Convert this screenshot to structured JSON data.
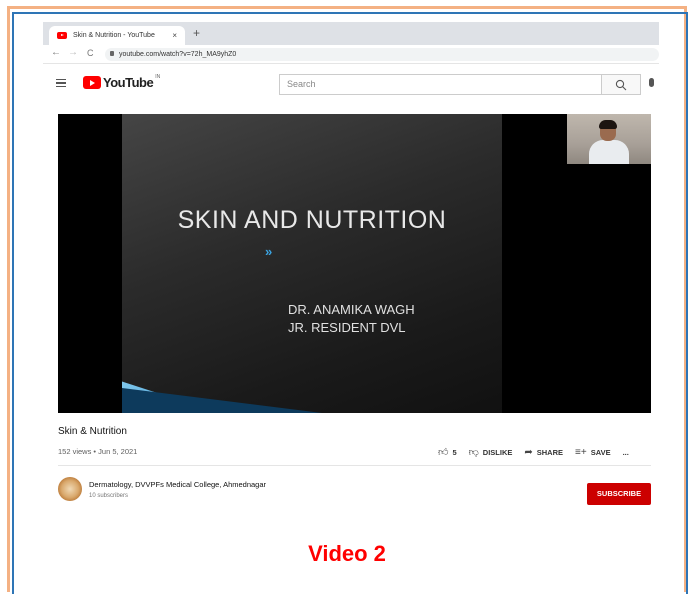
{
  "browser": {
    "tab_title": "Skin & Nutrition - YouTube",
    "tab_close": "×",
    "new_tab": "+",
    "back": "←",
    "forward": "→",
    "reload": "C",
    "url": "youtube.com/watch?v=72h_MA9yhZ0"
  },
  "youtube": {
    "logo_text": "YouTube",
    "region": "IN",
    "search_placeholder": "Search"
  },
  "slide": {
    "title": "SKIN AND NUTRITION",
    "arrow": "»",
    "presenter_line1": "DR. ANAMIKA WAGH",
    "presenter_line2": "JR. RESIDENT DVL"
  },
  "video": {
    "title": "Skin & Nutrition",
    "meta": "152 views • Jun 5, 2021",
    "likes": "5",
    "dislike_label": "DISLIKE",
    "share_label": "SHARE",
    "save_label": "SAVE",
    "more": "..."
  },
  "channel": {
    "name": "Dermatology, DVVPFs Medical College, Ahmednagar",
    "subscribers": "10 subscribers",
    "subscribe_label": "SUBSCRIBE"
  },
  "caption": "Video 2",
  "colors": {
    "frame_orange": "#f4b183",
    "frame_blue": "#2e75b6",
    "youtube_red": "#ff0000",
    "subscribe_red": "#cc0000",
    "caption_red": "#ff0000"
  }
}
